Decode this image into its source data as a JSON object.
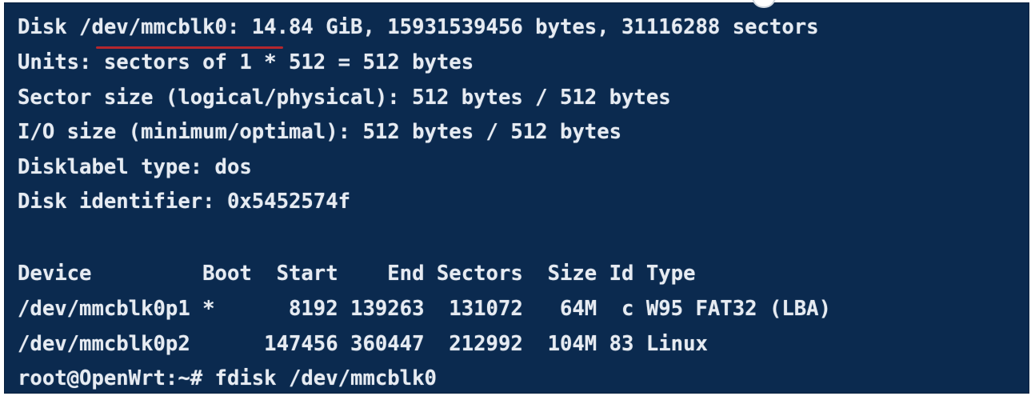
{
  "terminal": {
    "lines": [
      "Disk /dev/mmcblk0: 14.84 GiB, 15931539456 bytes, 31116288 sectors",
      "Units: sectors of 1 * 512 = 512 bytes",
      "Sector size (logical/physical): 512 bytes / 512 bytes",
      "I/O size (minimum/optimal): 512 bytes / 512 bytes",
      "Disklabel type: dos",
      "Disk identifier: 0x5452574f",
      "",
      "Device         Boot  Start    End Sectors  Size Id Type",
      "/dev/mmcblk0p1 *      8192 139263  131072   64M  c W95 FAT32 (LBA)",
      "/dev/mmcblk0p2      147456 360447  212992  104M 83 Linux",
      "root@OpenWrt:~# fdisk /dev/mmcblk0"
    ]
  },
  "colors": {
    "background": "#0b2a4f",
    "text": "#e6ebf2",
    "underline": "#b3262e"
  }
}
